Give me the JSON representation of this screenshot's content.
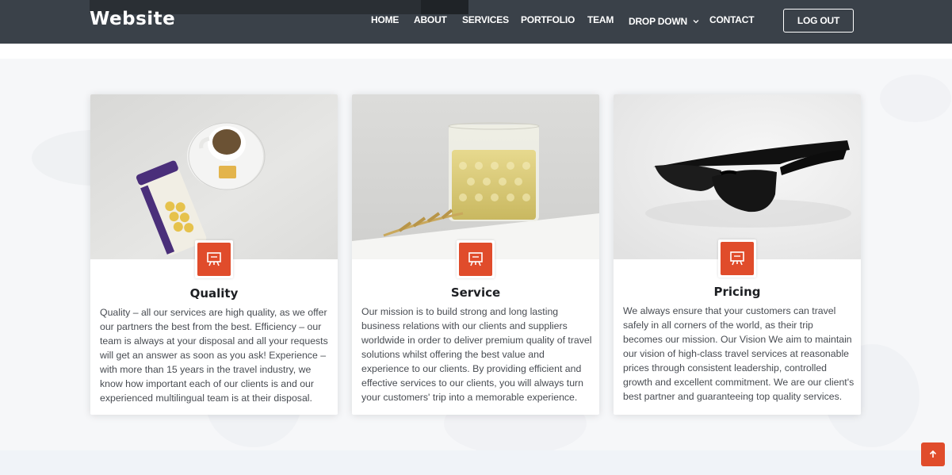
{
  "header": {
    "logo": "Website",
    "nav": [
      {
        "label": "HOME",
        "name": "nav-home"
      },
      {
        "label": "ABOUT",
        "name": "nav-about"
      },
      {
        "label": "SERVICES",
        "name": "nav-services"
      },
      {
        "label": "PORTFOLIO",
        "name": "nav-portfolio"
      },
      {
        "label": "TEAM",
        "name": "nav-team"
      },
      {
        "label": "DROP DOWN",
        "name": "nav-dropdown"
      },
      {
        "label": "CONTACT",
        "name": "nav-contact"
      }
    ],
    "logout_label": "LOG OUT"
  },
  "cards": [
    {
      "title": "Quality",
      "text": "Quality – all our services are high quality, as we offer our partners the best from the best. Efficiency – our team is always at your disposal and all your requests will get an answer as soon as you ask! Experience – with more than 15 years in the travel industry, we know how important each of our clients is and our experienced multilingual team is at their disposal.",
      "image": "honeycomb-tea-photo",
      "icon": "easel-icon"
    },
    {
      "title": "Service",
      "text": "Our mission is to build strong and long lasting business relations with our clients and suppliers worldwide in order to deliver premium quality of travel solutions whilst offering the best value and experience to our clients. By providing efficient and effective services to our clients, you will always turn your customers' trip into a memorable experience.",
      "image": "glass-wheat-photo",
      "icon": "easel-icon"
    },
    {
      "title": "Pricing",
      "text": "We always ensure that your customers can travel safely in all corners of the world, as their trip becomes our mission. Our Vision We aim to maintain our vision of high-class travel services at reasonable prices through consistent leadership, controlled growth and excellent commitment. We are our client's best partner and guaranteeing top quality services.",
      "image": "sunglasses-photo",
      "icon": "easel-icon"
    }
  ],
  "back_to_top_icon": "arrow-up-icon",
  "colors": {
    "header_bg": "#3a4149",
    "accent": "#e04c2b",
    "section_bg": "#f6f7f9"
  }
}
